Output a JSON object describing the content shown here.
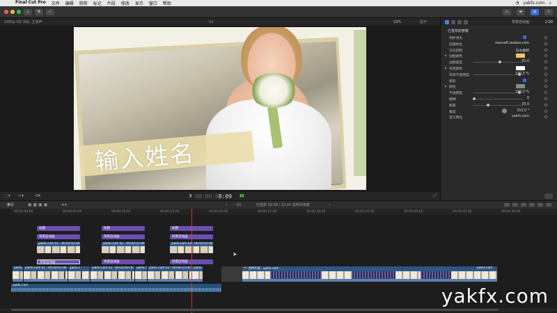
{
  "menubar": {
    "apple": "",
    "items": [
      "Final Cut Pro",
      "文件",
      "编辑",
      "修剪",
      "标记",
      "片段",
      "修改",
      "显示",
      "窗口",
      "帮助"
    ],
    "right_text": "yakfx.com"
  },
  "toolbar": {
    "undo_label": "↓",
    "key_label": "⌘",
    "check_label": "✓"
  },
  "viewer": {
    "format": "1080p HD 30p, 立体声",
    "clip_name": "V1",
    "zoom": "53%",
    "display": "显示",
    "timecode_dim": "00:00:0",
    "timecode": "8:09",
    "title_text": "输入姓名"
  },
  "inspector": {
    "title": "背景自动画",
    "duration": "2:00",
    "section": "已发布的参数",
    "rows": [
      {
        "label": "构件消失",
        "value": "",
        "type": "check"
      },
      {
        "label": "店铺地址",
        "value": "macsoft.taobao.com",
        "type": "text"
      },
      {
        "label": "方向控制",
        "value": "向左缓转",
        "type": "text"
      },
      {
        "label": "边框颜色",
        "value": "",
        "type": "swatch",
        "color": "#f4c86a"
      },
      {
        "label": "边框宽度",
        "value": "50.0",
        "type": "slider",
        "pos": 0.55
      },
      {
        "label": "背景颜色",
        "value": "",
        "type": "swatch",
        "color": "#ffffff"
      },
      {
        "label": "背景不透明度",
        "value": "100.0 %",
        "type": "slider",
        "pos": 0.95
      },
      {
        "label": "投影",
        "value": "",
        "type": "check"
      },
      {
        "label": "颜色",
        "value": "",
        "type": "swatch",
        "color": "#8a8a8a"
      },
      {
        "label": "不透明度",
        "value": "100.0 %",
        "type": "slider",
        "pos": 0.95
      },
      {
        "label": "模糊",
        "value": "0",
        "type": "slider",
        "pos": 0.0
      },
      {
        "label": "距离",
        "value": "35.0",
        "type": "slider",
        "pos": 0.3
      },
      {
        "label": "角度",
        "value": "315.0 °",
        "type": "dial"
      },
      {
        "label": "官方网址",
        "value": "yakfx.com",
        "type": "text"
      }
    ]
  },
  "timeline": {
    "index_label": "索引",
    "project_name": "V1",
    "status": "已选定 02:00 / 22:15 总时间长度",
    "ruler": [
      "00:00:00:00",
      "00:00:05:00",
      "00:00:10:00",
      "00:00:15:00",
      "00:00:20:00",
      "00:00:25:00",
      "00:00:30:00",
      "00:00:35:00",
      "00:00:40:00",
      "00:00:45:00",
      "00:00:50:00"
    ],
    "connected": [
      {
        "title1": "标题",
        "title2": "背景自动画",
        "media": "yakfx.com 01 - 00:00:01:00",
        "title3": "背景自动画"
      },
      {
        "title1": "标题",
        "title2": "背景自动画",
        "media": "yakfx.com 02 - 00:00:01:00",
        "title3": "背景自动画"
      },
      {
        "title1": "标题",
        "title2": "背景自动画",
        "media": "yakfx.com 03 - 00:00:01:00",
        "title3": "背景自动画"
      }
    ],
    "primary": [
      {
        "label": "yakfx.com 01",
        "w": 16
      },
      {
        "label": "yakfx.com 01 - 00:00:01:00",
        "w": 64
      },
      {
        "label": "yakfx.c",
        "w": 32
      },
      {
        "label": "yakfx.com 02 - 00:00:00:00",
        "w": 64
      },
      {
        "label": "yakfx.c",
        "w": 18
      },
      {
        "label": "yakfx.com 03 - 00:00:01:00",
        "w": 64
      },
      {
        "label": "yakfx.",
        "w": 16
      }
    ],
    "long_clip_label": "📷 宣传片段 · yakfx.com",
    "long_clip_end": "yakfx.com",
    "audio_label": "yakfx.com"
  },
  "watermark": "yakfx.com",
  "colors": {
    "accent": "#3d6bd9",
    "title_clip": "#6a4fb0",
    "media_clip": "#2d5686",
    "playhead": "#d23b3b"
  }
}
